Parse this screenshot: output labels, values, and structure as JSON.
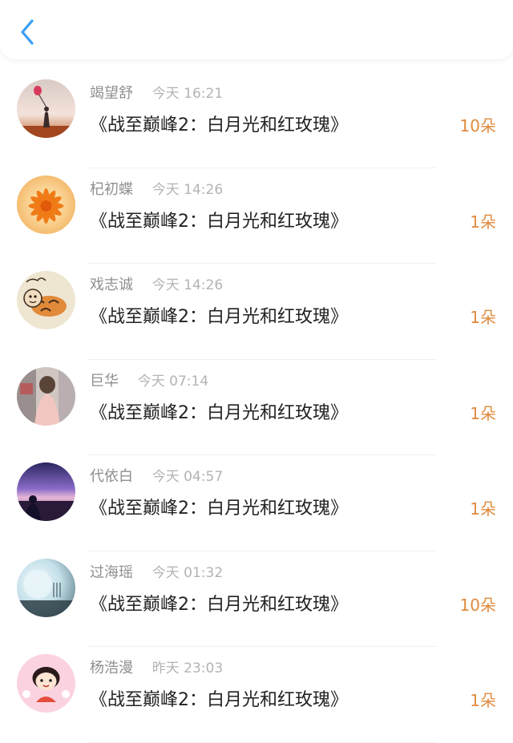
{
  "header": {
    "back_icon": "chevron-left-icon"
  },
  "colors": {
    "accent_blue": "#3a9ef5",
    "count_orange": "#e08a3e"
  },
  "items": [
    {
      "name": "竭望舒",
      "time": "今天 16:21",
      "title": "《战至巅峰2：白月光和红玫瑰》",
      "count": "10朵",
      "avatar": "silhouette-with-balloon"
    },
    {
      "name": "杞初蝶",
      "time": "今天 14:26",
      "title": "《战至巅峰2：白月光和红玫瑰》",
      "count": "1朵",
      "avatar": "orange-flower"
    },
    {
      "name": "戏志诚",
      "time": "今天 14:26",
      "title": "《战至巅峰2：白月光和红玫瑰》",
      "count": "1朵",
      "avatar": "cartoon-tiger"
    },
    {
      "name": "巨华",
      "time": "今天 07:14",
      "title": "《战至巅峰2：白月光和红玫瑰》",
      "count": "1朵",
      "avatar": "girl-back-view"
    },
    {
      "name": "代依白",
      "time": "今天 04:57",
      "title": "《战至巅峰2：白月光和红玫瑰》",
      "count": "1朵",
      "avatar": "purple-sunset-figure"
    },
    {
      "name": "过海瑶",
      "time": "今天 01:32",
      "title": "《战至巅峰2：白月光和红玫瑰》",
      "count": "10朵",
      "avatar": "moon-landscape"
    },
    {
      "name": "杨浩漫",
      "time": "昨天 23:03",
      "title": "《战至巅峰2：白月光和红玫瑰》",
      "count": "1朵",
      "avatar": "cartoon-girl-pink"
    }
  ]
}
